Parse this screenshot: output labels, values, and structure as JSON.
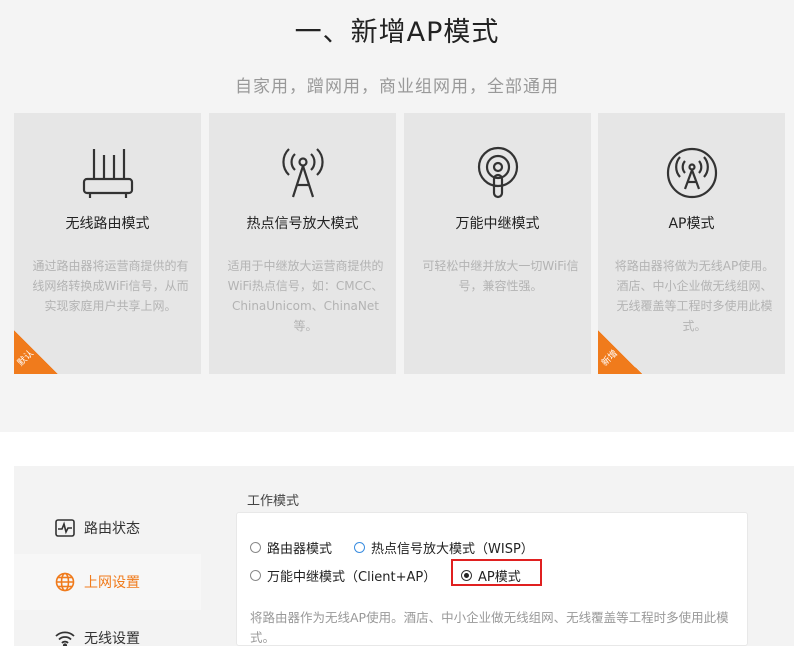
{
  "header": {
    "title": "一、新增AP模式",
    "subtitle": "自家用，蹭网用，商业组网用，全部通用"
  },
  "cards": [
    {
      "icon": "router-icon",
      "name": "无线路由模式",
      "desc": "通过路由器将运营商提供的有线网络转换成WiFi信号，从而实现家庭用户共享上网。",
      "badge": "默认"
    },
    {
      "icon": "signal-tower-icon",
      "name": "热点信号放大模式",
      "desc": "适用于中继放大运营商提供的WiFi热点信号，如：CMCC、ChinaUnicom、ChinaNet等。",
      "badge": ""
    },
    {
      "icon": "repeater-icon",
      "name": "万能中继模式",
      "desc": "可轻松中继并放大一切WiFi信号，兼容性强。",
      "badge": ""
    },
    {
      "icon": "ap-icon",
      "name": "AP模式",
      "desc": "将路由器将做为无线AP使用。酒店、中小企业做无线组网、无线覆盖等工程时多使用此模式。",
      "badge": "新增"
    }
  ],
  "sidebar": {
    "items": [
      {
        "label": "路由状态",
        "icon": "status-monitor-icon"
      },
      {
        "label": "上网设置",
        "icon": "globe-icon"
      },
      {
        "label": "无线设置",
        "icon": "wifi-icon"
      }
    ]
  },
  "settings": {
    "section_title": "工作模式",
    "options": [
      {
        "label": "路由器模式",
        "checked": false
      },
      {
        "label": "热点信号放大模式（WISP）",
        "checked": false
      },
      {
        "label": "万能中继模式（Client+AP）",
        "checked": false
      },
      {
        "label": "AP模式",
        "checked": true
      }
    ],
    "note": "将路由器作为无线AP使用。酒店、中小企业做无线组网、无线覆盖等工程时多使用此模式。"
  },
  "colors": {
    "accent": "#f07b1c",
    "highlight": "#e02020",
    "radio_blue": "#3a8de0"
  }
}
